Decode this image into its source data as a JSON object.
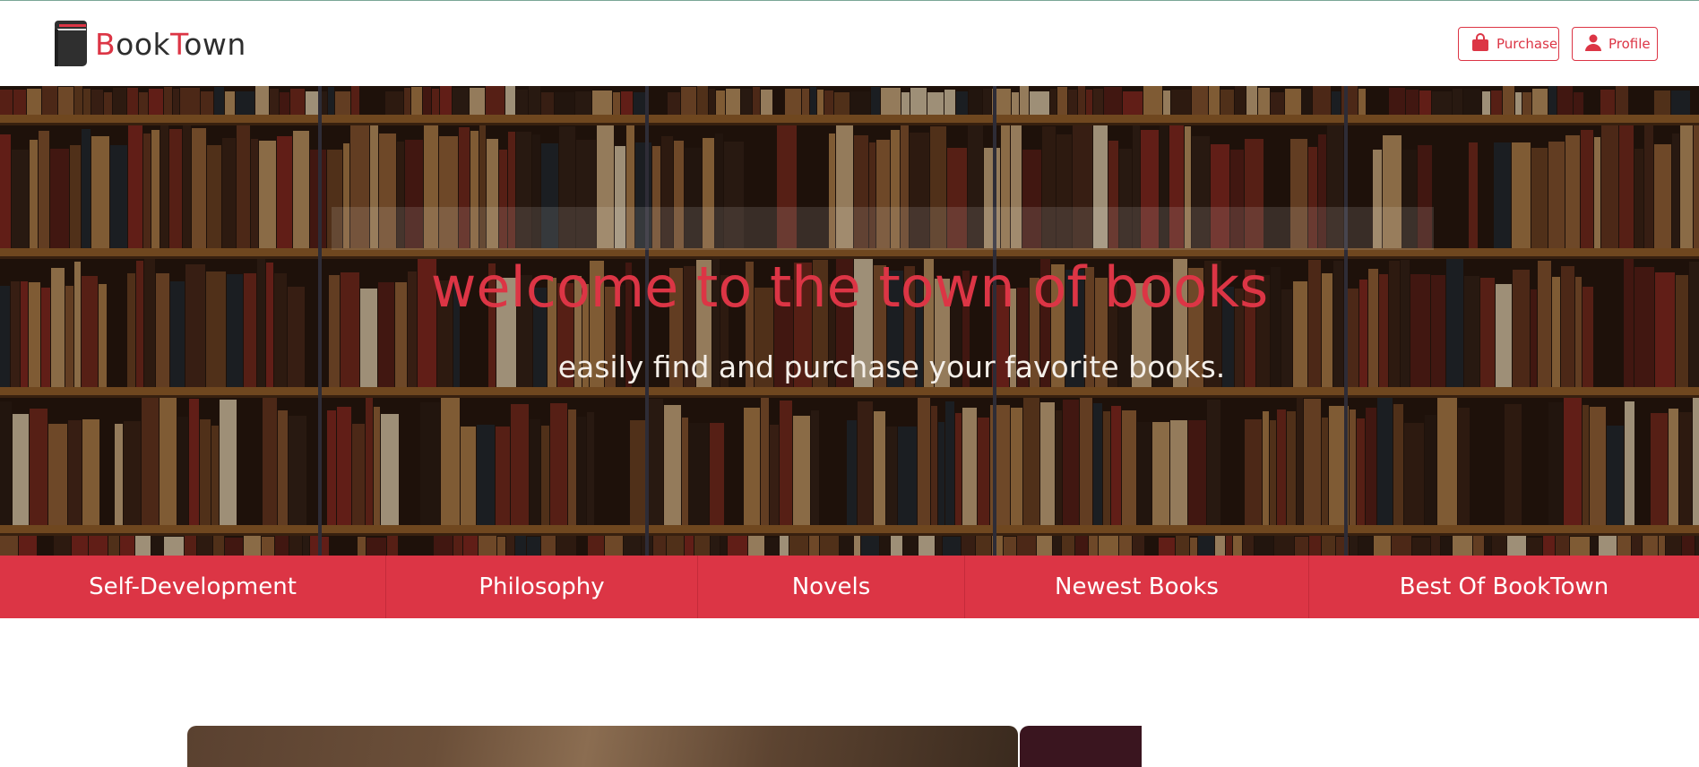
{
  "header": {
    "brand_parts": [
      "B",
      "ook",
      "T",
      "own"
    ],
    "logo_icon": "book-icon",
    "purchase_label": "Purchase",
    "purchase_icon": "shopping-bag-icon",
    "profile_label": "Profile",
    "profile_icon": "user-icon"
  },
  "hero": {
    "title": "welcome to the town of books",
    "subtitle": "easily find and purchase your favorite books."
  },
  "categories": [
    "Self-Development",
    "Philosophy",
    "Novels",
    "Newest Books",
    "Best Of BookTown"
  ],
  "colors": {
    "accent": "#dc3545",
    "text_dark": "#2e2e2e",
    "hero_subtitle": "#f4efe9"
  }
}
